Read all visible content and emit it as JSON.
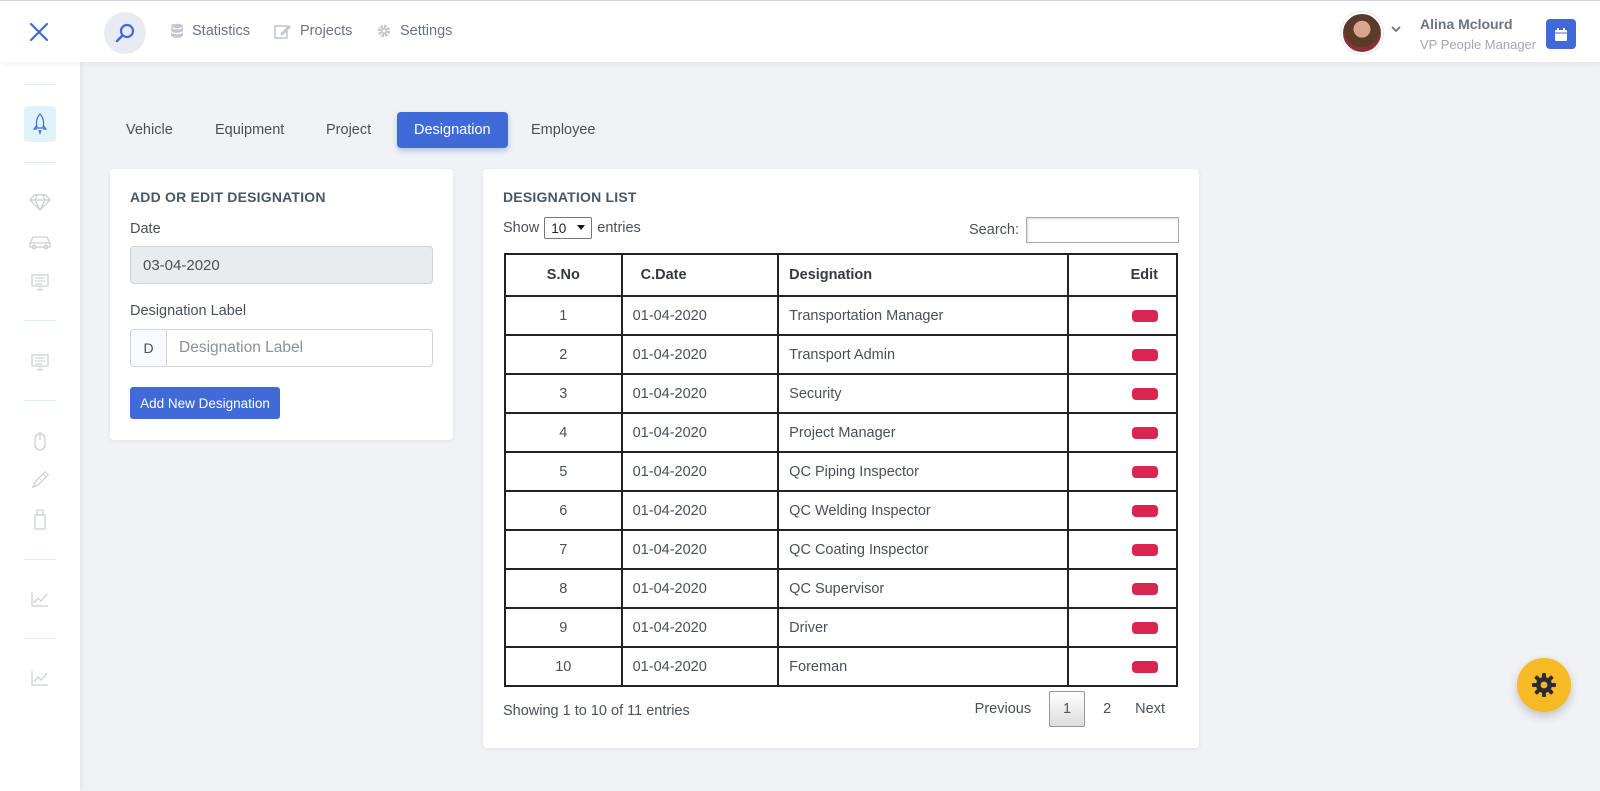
{
  "header": {
    "nav": [
      {
        "label": "Statistics",
        "icon": "database-icon"
      },
      {
        "label": "Projects",
        "icon": "edit-icon"
      },
      {
        "label": "Settings",
        "icon": "gear-icon"
      }
    ],
    "user": {
      "name": "Alina Mclourd",
      "role": "VP People Manager"
    }
  },
  "tabs": [
    {
      "label": "Vehicle",
      "active": false
    },
    {
      "label": "Equipment",
      "active": false
    },
    {
      "label": "Project",
      "active": false
    },
    {
      "label": "Designation",
      "active": true
    },
    {
      "label": "Employee",
      "active": false
    }
  ],
  "form": {
    "title": "ADD OR EDIT DESIGNATION",
    "date_label": "Date",
    "date_value": "03-04-2020",
    "designation_label": "Designation Label",
    "addon": "D",
    "designation_placeholder": "Designation Label",
    "submit_label": "Add New Designation"
  },
  "list": {
    "title": "DESIGNATION LIST",
    "show_prefix": "Show",
    "page_size": "10",
    "show_suffix": "entries",
    "search_label": "Search:",
    "columns": [
      "S.No",
      "C.Date",
      "Designation",
      "Edit"
    ],
    "rows": [
      {
        "sno": "1",
        "date": "01-04-2020",
        "designation": "Transportation Manager"
      },
      {
        "sno": "2",
        "date": "01-04-2020",
        "designation": "Transport Admin"
      },
      {
        "sno": "3",
        "date": "01-04-2020",
        "designation": "Security"
      },
      {
        "sno": "4",
        "date": "01-04-2020",
        "designation": "Project Manager"
      },
      {
        "sno": "5",
        "date": "01-04-2020",
        "designation": "QC Piping Inspector"
      },
      {
        "sno": "6",
        "date": "01-04-2020",
        "designation": "QC Welding Inspector"
      },
      {
        "sno": "7",
        "date": "01-04-2020",
        "designation": "QC Coating Inspector"
      },
      {
        "sno": "8",
        "date": "01-04-2020",
        "designation": "QC Supervisor"
      },
      {
        "sno": "9",
        "date": "01-04-2020",
        "designation": "Driver"
      },
      {
        "sno": "10",
        "date": "01-04-2020",
        "designation": "Foreman"
      }
    ],
    "info": "Showing 1 to 10 of 11 entries",
    "pagination": {
      "previous": "Previous",
      "pages": [
        "1",
        "2"
      ],
      "current": "1",
      "next": "Next"
    }
  },
  "colors": {
    "primary": "#3f6ad8",
    "danger": "#d92550",
    "warning": "#f7b924"
  }
}
